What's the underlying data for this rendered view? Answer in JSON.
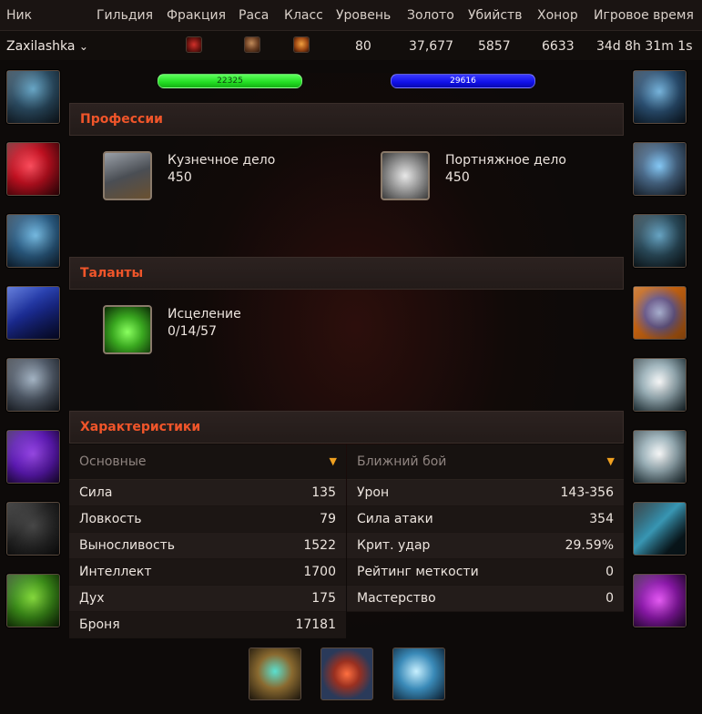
{
  "header": {
    "nick": "Ник",
    "guild": "Гильдия",
    "faction": "Фракция",
    "race": "Раса",
    "class": "Класс",
    "level": "Уровень",
    "gold": "Золото",
    "kills": "Убийств",
    "honor": "Хонор",
    "playtime": "Игровое время"
  },
  "character": {
    "name": "Zaxilashka",
    "name_chevron": "⌄",
    "faction_icon": "horde-faction-icon",
    "race_icon": "race-portrait-icon",
    "class_icon": "class-emblem-icon",
    "level": "80",
    "gold": "37,677",
    "kills": "5857",
    "honor": "6633",
    "playtime": "34d 8h 31m 1s"
  },
  "bars": {
    "health": "22325",
    "mana": "29616",
    "health_color": "#22dd22",
    "mana_color": "#1010e8"
  },
  "professions": {
    "title": "Профессии",
    "items": [
      {
        "name": "Кузнечное дело",
        "value": "450",
        "icon": "anvil-icon"
      },
      {
        "name": "Портняжное дело",
        "value": "450",
        "icon": "thread-spool-icon"
      }
    ]
  },
  "talents": {
    "title": "Таланты",
    "items": [
      {
        "name": "Исцеление",
        "value": "0/14/57",
        "icon": "healing-touch-icon"
      }
    ]
  },
  "stats": {
    "title": "Характеристики",
    "left": {
      "header": "Основные",
      "chevron": "▼",
      "rows": [
        {
          "name": "Сила",
          "value": "135"
        },
        {
          "name": "Ловкость",
          "value": "79"
        },
        {
          "name": "Выносливость",
          "value": "1522"
        },
        {
          "name": "Интеллект",
          "value": "1700"
        },
        {
          "name": "Дух",
          "value": "175"
        },
        {
          "name": "Броня",
          "value": "17181"
        }
      ]
    },
    "right": {
      "header": "Ближний бой",
      "chevron": "▼",
      "rows": [
        {
          "name": "Урон",
          "value": "143-356"
        },
        {
          "name": "Сила атаки",
          "value": "354"
        },
        {
          "name": "Крит. удар",
          "value": "29.59%"
        },
        {
          "name": "Рейтинг меткости",
          "value": "0"
        },
        {
          "name": "Мастерство",
          "value": "0"
        }
      ]
    }
  },
  "equipment": {
    "left": [
      "head-slot-icon",
      "neck-gem-icon",
      "shoulder-slot-icon",
      "back-cloak-icon",
      "chest-armor-icon",
      "shirt-icon",
      "tabard-icon",
      "wrist-slot-icon"
    ],
    "right": [
      "hands-slot-icon",
      "waist-slot-icon",
      "legs-slot-icon",
      "feet-boots-icon",
      "ring-1-icon",
      "ring-2-icon",
      "trinket-1-icon",
      "trinket-2-icon"
    ],
    "bottom": [
      "main-hand-icon",
      "off-hand-icon",
      "relic-icon"
    ]
  },
  "colors": {
    "accent": "#f0552a",
    "chevron": "#f0a020"
  }
}
